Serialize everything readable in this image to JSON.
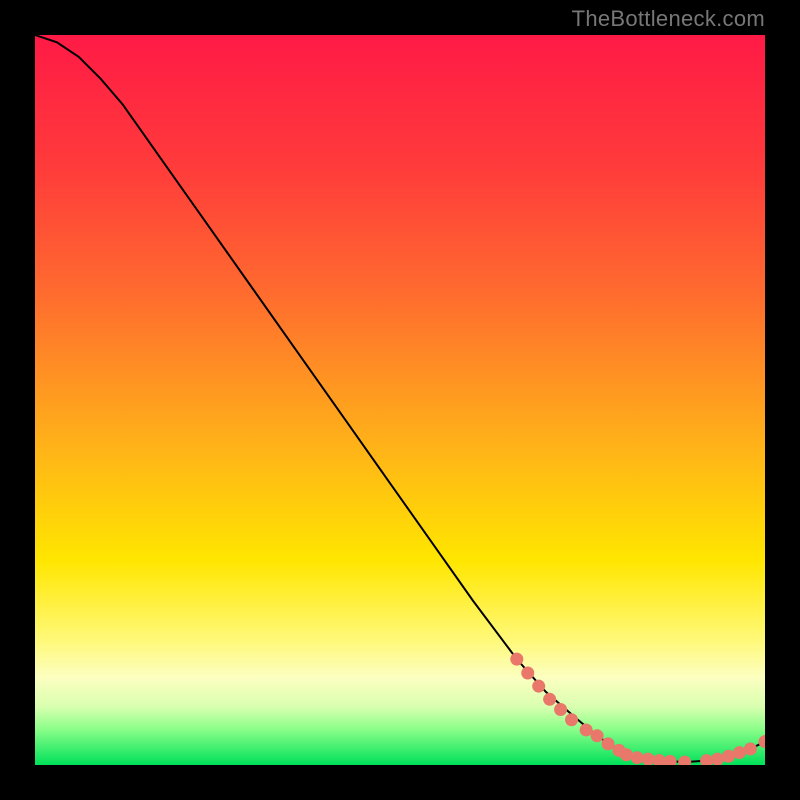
{
  "watermark": "TheBottleneck.com",
  "colors": {
    "stop0": "#ff1a46",
    "stop18": "#ff3b3b",
    "stop35": "#ff6a2f",
    "stop55": "#ffae1a",
    "stop72": "#ffe600",
    "stop83": "#fff97a",
    "stop88": "#fcffc0",
    "stop92": "#d9ffb0",
    "stop95": "#8dff8a",
    "stop100": "#00e05a",
    "curve": "#000000",
    "dot": "#e9776a"
  },
  "chart_data": {
    "type": "line",
    "title": "",
    "xlabel": "",
    "ylabel": "",
    "xlim": [
      0,
      100
    ],
    "ylim": [
      0,
      100
    ],
    "curve": {
      "x": [
        0,
        3,
        6,
        9,
        12,
        18,
        24,
        30,
        36,
        42,
        48,
        54,
        60,
        66,
        70,
        74,
        77,
        80,
        83,
        86,
        89,
        92,
        95,
        98,
        100
      ],
      "y": [
        100,
        99,
        97,
        94,
        90.5,
        82,
        73.5,
        65,
        56.5,
        48,
        39.5,
        31,
        22.5,
        14.5,
        10,
        6.5,
        4,
        2,
        1,
        0.6,
        0.4,
        0.6,
        1.2,
        2.2,
        3.2
      ]
    },
    "dots": {
      "x": [
        66,
        67.5,
        69,
        70.5,
        72,
        73.5,
        75.5,
        77,
        78.5,
        80,
        81,
        82.5,
        84,
        85.5,
        87,
        89,
        92,
        93.5,
        95,
        96.5,
        98,
        100
      ],
      "y": [
        14.5,
        12.6,
        10.8,
        9.0,
        7.6,
        6.2,
        4.8,
        4.0,
        2.9,
        2.0,
        1.4,
        1.0,
        0.8,
        0.6,
        0.5,
        0.4,
        0.6,
        0.8,
        1.2,
        1.7,
        2.2,
        3.2
      ]
    }
  }
}
